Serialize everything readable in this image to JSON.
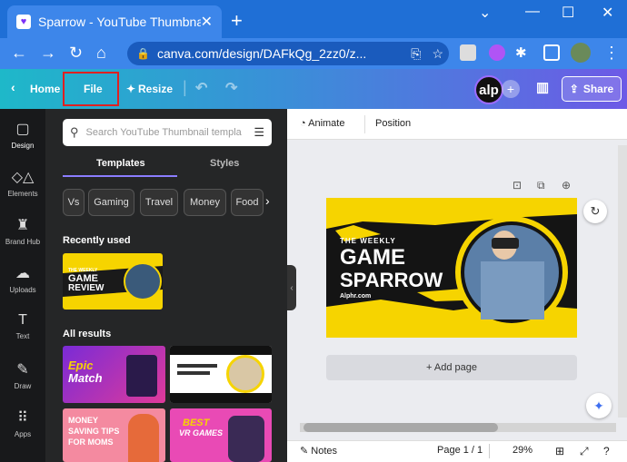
{
  "browser": {
    "tab_title": "Sparrow - YouTube Thumbnail",
    "tab_close": "✕",
    "new_tab": "+",
    "minimize": "—",
    "maximize": "☐",
    "close": "✕",
    "url": "canva.com/design/DAFkQg_2zz0/z..."
  },
  "topbar": {
    "home_label": "Home",
    "file_label": "File",
    "resize_label": "Resize",
    "avatar_text": "alp",
    "share_label": "Share"
  },
  "rail": {
    "items": [
      {
        "label": "Design",
        "icon": "▢"
      },
      {
        "label": "Elements",
        "icon": "◇△"
      },
      {
        "label": "Brand Hub",
        "icon": "♜"
      },
      {
        "label": "Uploads",
        "icon": "☁"
      },
      {
        "label": "Text",
        "icon": "T"
      },
      {
        "label": "Draw",
        "icon": "✎"
      },
      {
        "label": "Apps",
        "icon": "⠿"
      }
    ]
  },
  "panel": {
    "search_placeholder": "Search YouTube Thumbnail templa",
    "tabs": [
      "Templates",
      "Styles"
    ],
    "chips": [
      "Vs",
      "Gaming",
      "Travel",
      "Money",
      "Food"
    ],
    "recently_used": "Recently used",
    "all_results": "All results",
    "recent_thumb": {
      "line1": "THE WEEKLY",
      "line2": "GAME",
      "line3": "REVIEW"
    },
    "results": [
      {
        "title": "Epic",
        "title2": "Match",
        "bg": "#7a2bd6"
      },
      {
        "title": "",
        "title2": "",
        "bg": "#ffffff"
      },
      {
        "title": "MONEY",
        "title2": "SAVING TIPS",
        "title3": "FOR MOMS",
        "bg": "#f48aa0"
      },
      {
        "title": "BEST",
        "title2": "VR GAMES",
        "bg": "#e94ab5"
      }
    ]
  },
  "canvas_toolbar": {
    "animate": "Animate",
    "position": "Position"
  },
  "design": {
    "line1": "THE WEEKLY",
    "line2": "GAME",
    "line3": "SPARROW",
    "site": "Alphr.com"
  },
  "canvas": {
    "add_page": "+ Add page"
  },
  "bottom": {
    "notes": "Notes",
    "page": "Page 1 / 1",
    "zoom": "29%"
  },
  "colors": {
    "accent_yellow": "#f6d400",
    "panel_bg": "#252627",
    "rail_bg": "#18191b",
    "highlight_box": "#e02020"
  }
}
